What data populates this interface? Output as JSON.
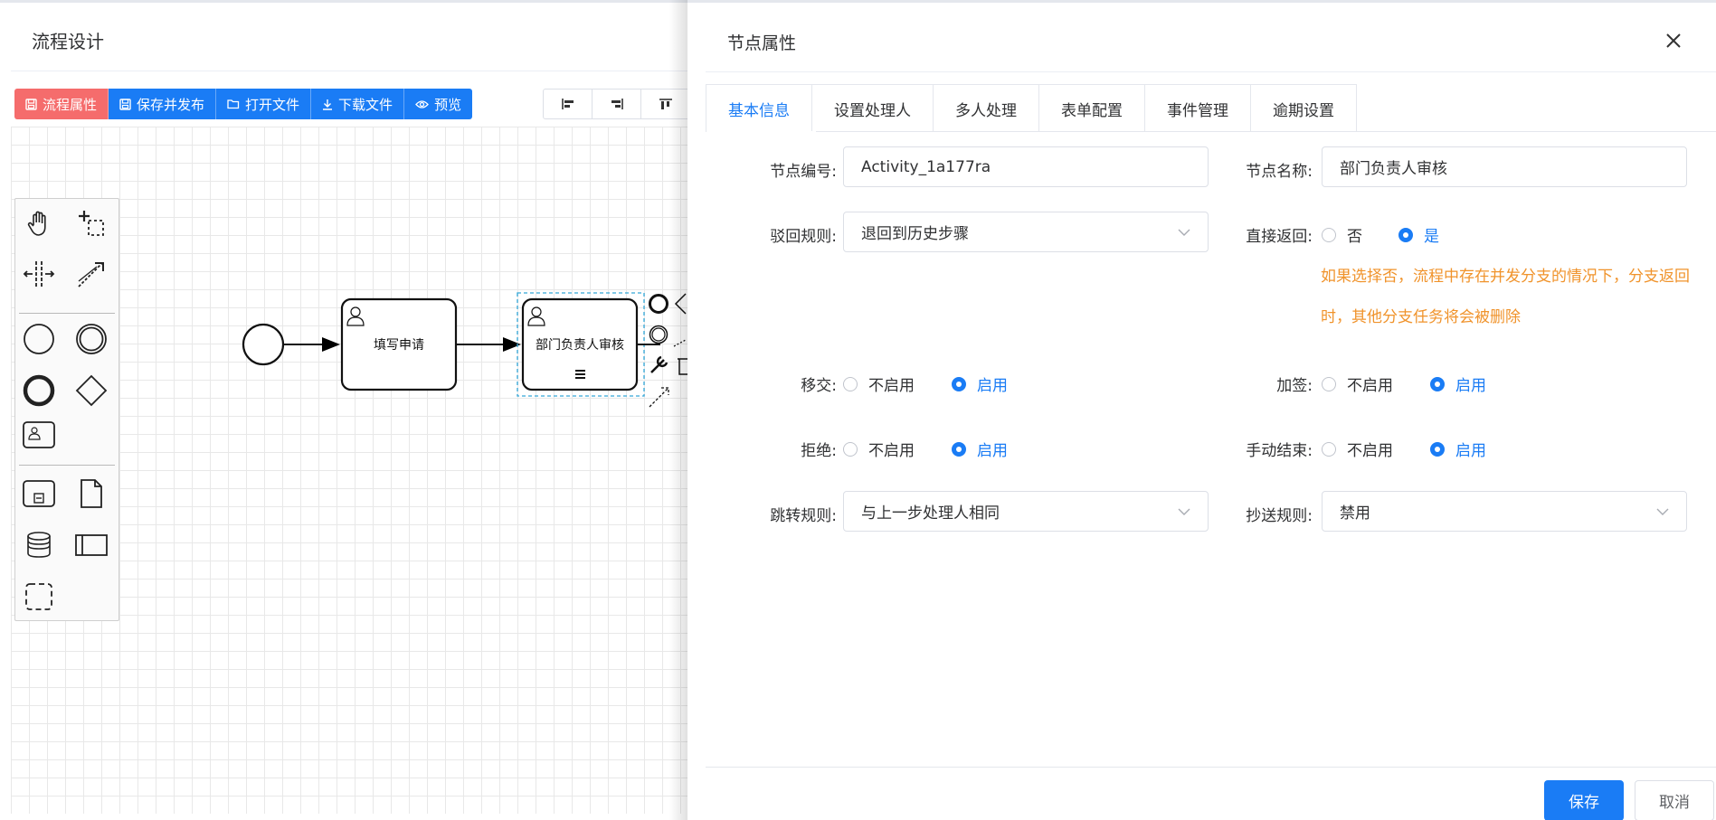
{
  "designer": {
    "title": "流程设计",
    "toolbar": [
      {
        "label": "流程属性",
        "icon": "save-icon"
      },
      {
        "label": "保存并发布",
        "icon": "save-icon"
      },
      {
        "label": "打开文件",
        "icon": "folder-open-icon"
      },
      {
        "label": "下载文件",
        "icon": "download-icon"
      },
      {
        "label": "预览",
        "icon": "eye-icon"
      }
    ],
    "align_tools": [
      "align-left-icon",
      "align-right-icon",
      "align-top-icon"
    ],
    "palette": [
      "hand-tool-icon",
      "lasso-tool-icon",
      "space-tool-icon",
      "connect-tool-icon",
      "start-event-icon",
      "intermediate-event-icon",
      "end-event-icon",
      "gateway-icon",
      "user-task-icon",
      "subprocess-icon",
      "data-object-icon",
      "data-store-icon",
      "pool-icon",
      "group-icon"
    ],
    "diagram": {
      "task1": "填写申请",
      "task2": "部门负责人审核"
    },
    "colors": {
      "danger": "#f56c6c",
      "primary": "#1a7cf5"
    }
  },
  "drawer": {
    "title": "节点属性",
    "tabs": [
      "基本信息",
      "设置处理人",
      "多人处理",
      "表单配置",
      "事件管理",
      "逾期设置"
    ],
    "active_tab": "基本信息",
    "form": {
      "node_id_label": "节点编号:",
      "node_id_value": "Activity_1a177ra",
      "node_name_label": "节点名称:",
      "node_name_value": "部门负责人审核",
      "reject_rule_label": "驳回规则:",
      "reject_rule_value": "退回到历史步骤",
      "direct_return_label": "直接返回:",
      "direct_return_no": "否",
      "direct_return_yes": "是",
      "hint": "如果选择否，流程中存在并发分支的情况下，分支返回时，其他分支任务将会被删除",
      "transfer_label": "移交:",
      "countersign_label": "加签:",
      "refuse_label": "拒绝:",
      "manual_end_label": "手动结束:",
      "disabled": "不启用",
      "enabled": "启用",
      "jump_rule_label": "跳转规则:",
      "jump_rule_value": "与上一步处理人相同",
      "cc_rule_label": "抄送规则:",
      "cc_rule_value": "禁用"
    },
    "save_label": "保存",
    "cancel_label": "取消"
  }
}
